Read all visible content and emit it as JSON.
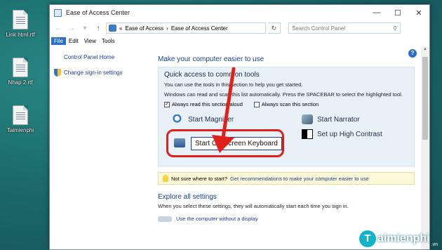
{
  "desktop": {
    "icons": [
      {
        "label": "Link html.rtf",
        "icon": "rtf-file-icon"
      },
      {
        "label": "Nhap 2.rtf",
        "icon": "rtf-file-icon"
      },
      {
        "label": "Taimienphi",
        "icon": "rtf-file-icon"
      }
    ]
  },
  "window": {
    "title": "Ease of Access Center",
    "controls": {
      "minimize": "—",
      "maximize": "☐",
      "close": "✕"
    },
    "address": {
      "back": "←",
      "forward": "→",
      "up": "↑",
      "dropdown": "▾",
      "sep": "«",
      "crumb1": "Ease of Access",
      "arrow": "›",
      "crumb2": "Ease of Access Center",
      "refresh": "↻",
      "search_placeholder": "Search Control Panel",
      "search_icon": "⚲"
    },
    "menu": [
      "File",
      "Edit",
      "View",
      "Tools"
    ],
    "sidebar": {
      "home": "Control Panel Home",
      "signin": "Change sign-in settings"
    },
    "main": {
      "heading": "Make your computer easier to use",
      "panel_title": "Quick access to common tools",
      "panel_text1": "You can use the tools in this section to help you get started.",
      "panel_text2": "Windows can read and scan this list automatically. Press the SPACEBAR to select the highlighted tool.",
      "check1": "Always read this section aloud",
      "check2": "Always scan this section",
      "check1_mark": "✓",
      "tools": {
        "magnifier": "Start Magnifier",
        "narrator": "Start Narrator",
        "keyboard": "Start On-Screen Keyboard",
        "contrast": "Set up High Contrast"
      },
      "tip_prefix": "Not sure where to start?",
      "tip_link": "Get recommendations to make your computer easier to use",
      "explore_title": "Explore all settings",
      "explore_text": "When you select these settings, they will automatically start each time you sign in.",
      "explore_sub": "Use the computer without a display"
    },
    "help": "?"
  },
  "watermark": {
    "logo": "T",
    "text": "aimienphi",
    "suffix": ".vn"
  },
  "colors": {
    "highlight": "#e0201b",
    "link": "#1a3e8f",
    "accent": "#2a6fc9"
  }
}
